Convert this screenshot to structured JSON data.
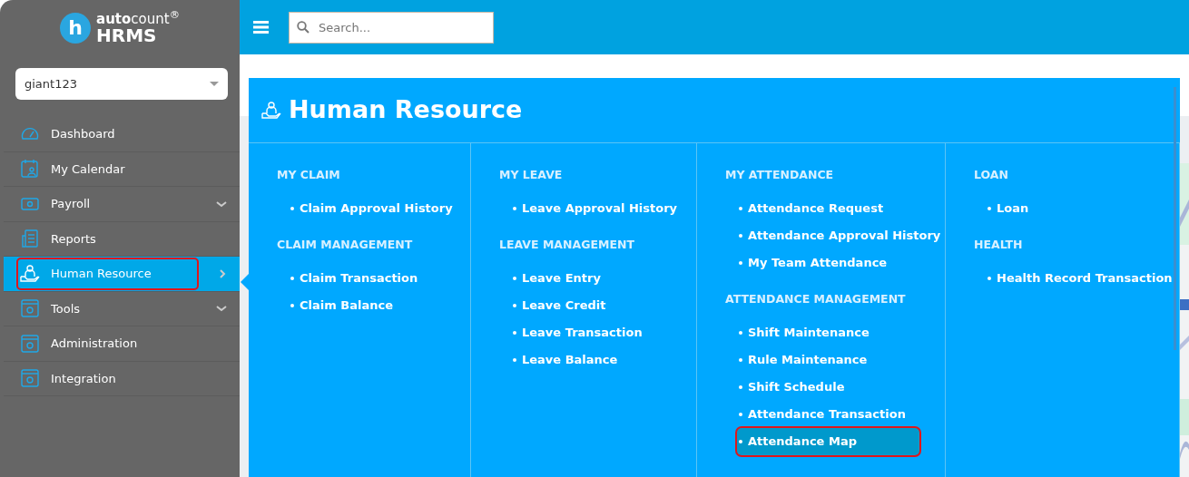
{
  "logo": {
    "mark": "h",
    "brand": "**auto**count$^{®}$",
    "product": "HRMS"
  },
  "company_select": {
    "value": "giant123"
  },
  "sidebar": {
    "items": [
      {
        "label": "Dashboard",
        "selected": false,
        "outlined": false,
        "has_children": false
      },
      {
        "label": "My Calendar",
        "selected": false,
        "outlined": false,
        "has_children": false
      },
      {
        "label": "Payroll",
        "selected": false,
        "outlined": false,
        "has_children": true
      },
      {
        "label": "Reports",
        "selected": false,
        "outlined": false,
        "has_children": false
      },
      {
        "label": "Human Resource",
        "selected": true,
        "outlined": true,
        "has_children": true
      },
      {
        "label": "Tools",
        "selected": false,
        "outlined": false,
        "has_children": true
      },
      {
        "label": "Administration",
        "selected": false,
        "outlined": false,
        "has_children": false
      },
      {
        "label": "Integration",
        "selected": false,
        "outlined": false,
        "has_children": false
      }
    ]
  },
  "topbar": {
    "search": {
      "placeholder": "Search..."
    }
  },
  "mega_menu": {
    "title": "Human Resource",
    "columns": [
      {
        "sections": [
          {
            "heading": "MY CLAIM",
            "items": [
              {
                "label": "Claim Approval History",
                "selected": false,
                "outlined": false
              }
            ]
          },
          {
            "heading": "CLAIM MANAGEMENT",
            "items": [
              {
                "label": "Claim Transaction",
                "selected": false,
                "outlined": false
              },
              {
                "label": "Claim Balance",
                "selected": false,
                "outlined": false
              }
            ]
          }
        ]
      },
      {
        "sections": [
          {
            "heading": "MY LEAVE",
            "items": [
              {
                "label": "Leave Approval History",
                "selected": false,
                "outlined": false
              }
            ]
          },
          {
            "heading": "LEAVE MANAGEMENT",
            "items": [
              {
                "label": "Leave Entry",
                "selected": false,
                "outlined": false
              },
              {
                "label": "Leave Credit",
                "selected": false,
                "outlined": false
              },
              {
                "label": "Leave Transaction",
                "selected": false,
                "outlined": false
              },
              {
                "label": "Leave Balance",
                "selected": false,
                "outlined": false
              }
            ]
          }
        ]
      },
      {
        "sections": [
          {
            "heading": "MY ATTENDANCE",
            "items": [
              {
                "label": "Attendance Request",
                "selected": false,
                "outlined": false
              },
              {
                "label": "Attendance Approval History",
                "selected": false,
                "outlined": false
              },
              {
                "label": "My Team Attendance",
                "selected": false,
                "outlined": false
              }
            ]
          },
          {
            "heading": "ATTENDANCE MANAGEMENT",
            "items": [
              {
                "label": "Shift Maintenance",
                "selected": false,
                "outlined": false
              },
              {
                "label": "Rule Maintenance",
                "selected": false,
                "outlined": false
              },
              {
                "label": "Shift Schedule",
                "selected": false,
                "outlined": false
              },
              {
                "label": "Attendance Transaction",
                "selected": false,
                "outlined": false
              },
              {
                "label": "Attendance Map",
                "selected": true,
                "outlined": true
              }
            ]
          }
        ]
      },
      {
        "sections": [
          {
            "heading": "LOAN",
            "items": [
              {
                "label": "Loan",
                "selected": false,
                "outlined": false
              }
            ]
          },
          {
            "heading": "HEALTH",
            "items": [
              {
                "label": "Health Record Transaction",
                "selected": false,
                "outlined": false
              }
            ]
          }
        ]
      }
    ]
  }
}
